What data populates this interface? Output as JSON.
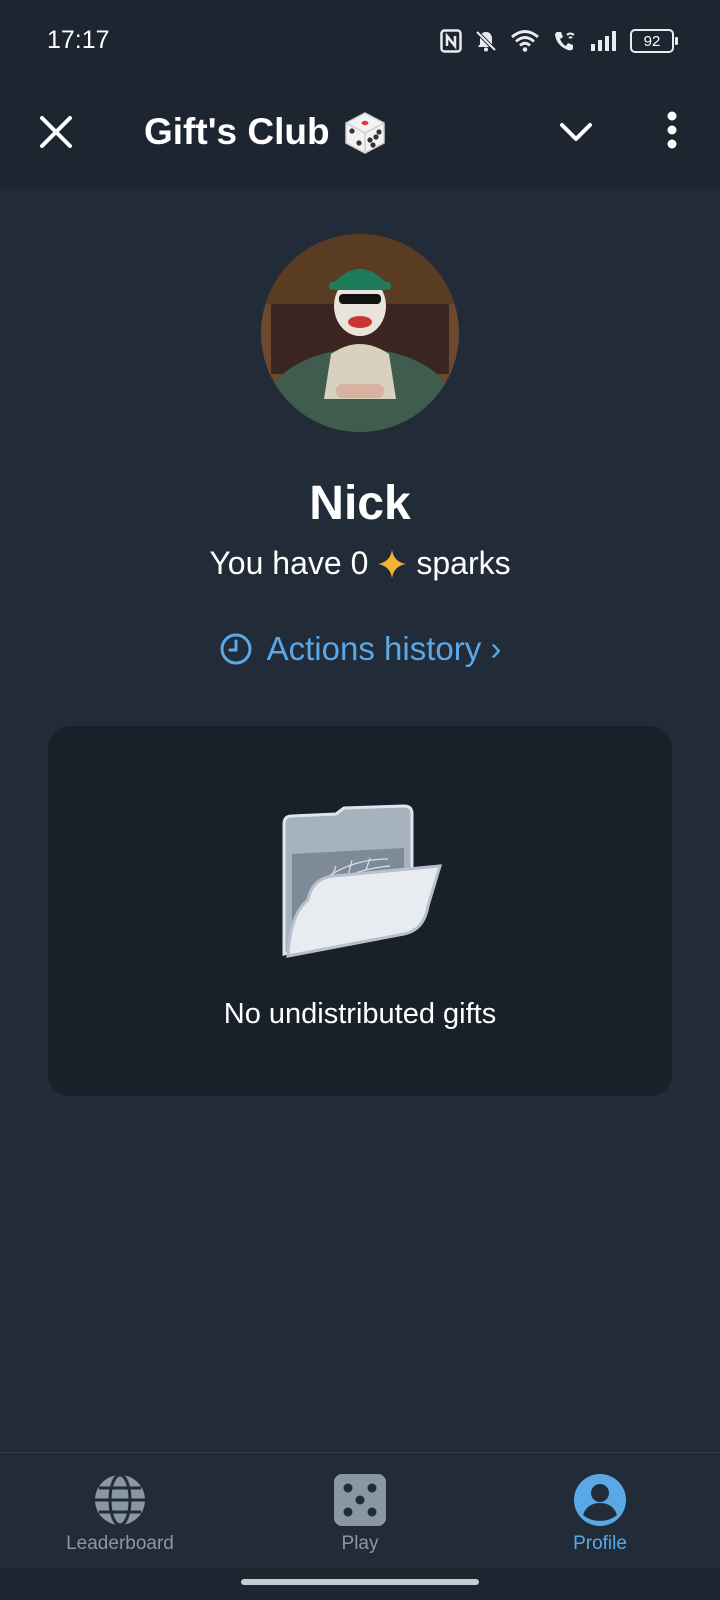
{
  "status_bar": {
    "time": "17:17",
    "battery": "92",
    "icons": [
      "nfc-icon",
      "bell-off-icon",
      "wifi-icon",
      "wifi-call-icon",
      "signal-icon",
      "battery-icon"
    ]
  },
  "header": {
    "title": "Gift's Club",
    "title_emoji": "🎲",
    "icons": {
      "close": "close-icon",
      "collapse": "chevron-down-icon",
      "menu": "more-vertical-icon"
    }
  },
  "profile": {
    "name": "Nick",
    "sparks_prefix": "You have 0",
    "sparks_suffix": "sparks",
    "sparks_icon": "sparkle-icon",
    "actions_history_label": "Actions history ›"
  },
  "gifts": {
    "empty_text": "No undistributed gifts",
    "illustration": "empty-folder-cobweb"
  },
  "bottom_nav": {
    "items": [
      {
        "label": "Leaderboard",
        "icon": "globe-icon",
        "active": false
      },
      {
        "label": "Play",
        "icon": "dice-icon",
        "active": false
      },
      {
        "label": "Profile",
        "icon": "profile-icon",
        "active": true
      }
    ]
  },
  "colors": {
    "background": "#222b38",
    "bar": "#1d2531",
    "card": "#18202a",
    "accent": "#5aa8e6",
    "sparkle": "#f5b335",
    "inactive": "#8b96a5"
  }
}
